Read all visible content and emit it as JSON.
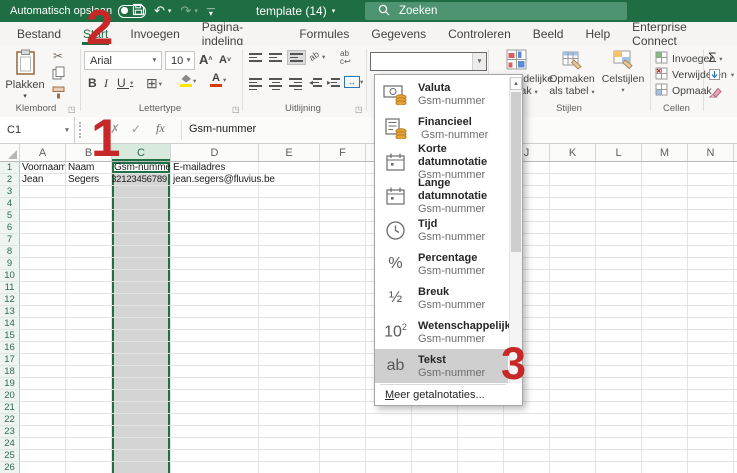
{
  "titlebar": {
    "autosave_label": "Automatisch opslaan",
    "autosave_state": "off",
    "document_title": "template (14)",
    "search_placeholder": "Zoeken"
  },
  "tabs": [
    {
      "label": "Bestand",
      "active": false
    },
    {
      "label": "Start",
      "active": true
    },
    {
      "label": "Invoegen",
      "active": false
    },
    {
      "label": "Pagina-indeling",
      "active": false
    },
    {
      "label": "Formules",
      "active": false
    },
    {
      "label": "Gegevens",
      "active": false
    },
    {
      "label": "Controleren",
      "active": false
    },
    {
      "label": "Beeld",
      "active": false
    },
    {
      "label": "Help",
      "active": false
    },
    {
      "label": "Enterprise Connect",
      "active": false
    }
  ],
  "ribbon": {
    "clipboard": {
      "paste_label": "Plakken",
      "group_label": "Klembord"
    },
    "font": {
      "family": "Arial",
      "size": "10",
      "group_label": "Lettertype"
    },
    "alignment": {
      "group_label": "Uitlijning"
    },
    "styles": {
      "conditional_line1": "Voorwaardelijke",
      "conditional_line2": "opmaak",
      "format_table_line1": "Opmaken",
      "format_table_line2": "als tabel",
      "cell_styles_label": "Celstijlen",
      "group_label": "Stijlen"
    },
    "cells": {
      "insert_label": "Invoegen",
      "delete_label": "Verwijderen",
      "format_label": "Opmaak",
      "group_label": "Cellen"
    }
  },
  "formula_bar": {
    "name_box": "C1",
    "content": "Gsm-nummer"
  },
  "number_format_dropdown": {
    "items": [
      {
        "label": "Valuta",
        "sample": "Gsm-nummer",
        "icon": "currency",
        "highlighted": false
      },
      {
        "label": "Financieel",
        "sample": " Gsm-nummer",
        "icon": "accounting",
        "highlighted": false
      },
      {
        "label": "Korte datumnotatie",
        "sample": "Gsm-nummer",
        "icon": "calendar",
        "highlighted": false
      },
      {
        "label": "Lange datumnotatie",
        "sample": "Gsm-nummer",
        "icon": "calendar",
        "highlighted": false
      },
      {
        "label": "Tijd",
        "sample": "Gsm-nummer",
        "icon": "clock",
        "highlighted": false
      },
      {
        "label": "Percentage",
        "sample": "Gsm-nummer",
        "icon": "percent",
        "highlighted": false
      },
      {
        "label": "Breuk",
        "sample": "Gsm-nummer",
        "icon": "fraction",
        "highlighted": false
      },
      {
        "label": "Wetenschappelijk",
        "sample": "Gsm-nummer",
        "icon": "scientific",
        "highlighted": false
      },
      {
        "label": "Tekst",
        "sample": "Gsm-nummer",
        "icon": "text",
        "highlighted": true
      }
    ],
    "footer": "Meer getalnotaties..."
  },
  "grid": {
    "column_letters": [
      "A",
      "B",
      "C",
      "D",
      "E",
      "F",
      "G",
      "H",
      "I",
      "J",
      "K",
      "L",
      "M",
      "N"
    ],
    "visible_rows": 26,
    "selected_column": "C",
    "active_cell": "C1",
    "cells": {
      "A1": "Voornaam",
      "B1": "Naam",
      "C1": "Gsm-nummer",
      "D1": "E-mailadres",
      "A2": "Jean",
      "B2": "Segers",
      "C2": "32123456789",
      "D2": "jean.segers@fluvius.be"
    }
  },
  "annotations": [
    {
      "label": "1"
    },
    {
      "label": "2"
    },
    {
      "label": "3"
    }
  ],
  "colors": {
    "excel_green": "#1f6e43",
    "selection_border_green": "#1f7145",
    "annotation_red": "#c62828",
    "selection_fill": "#d4d4d4"
  }
}
